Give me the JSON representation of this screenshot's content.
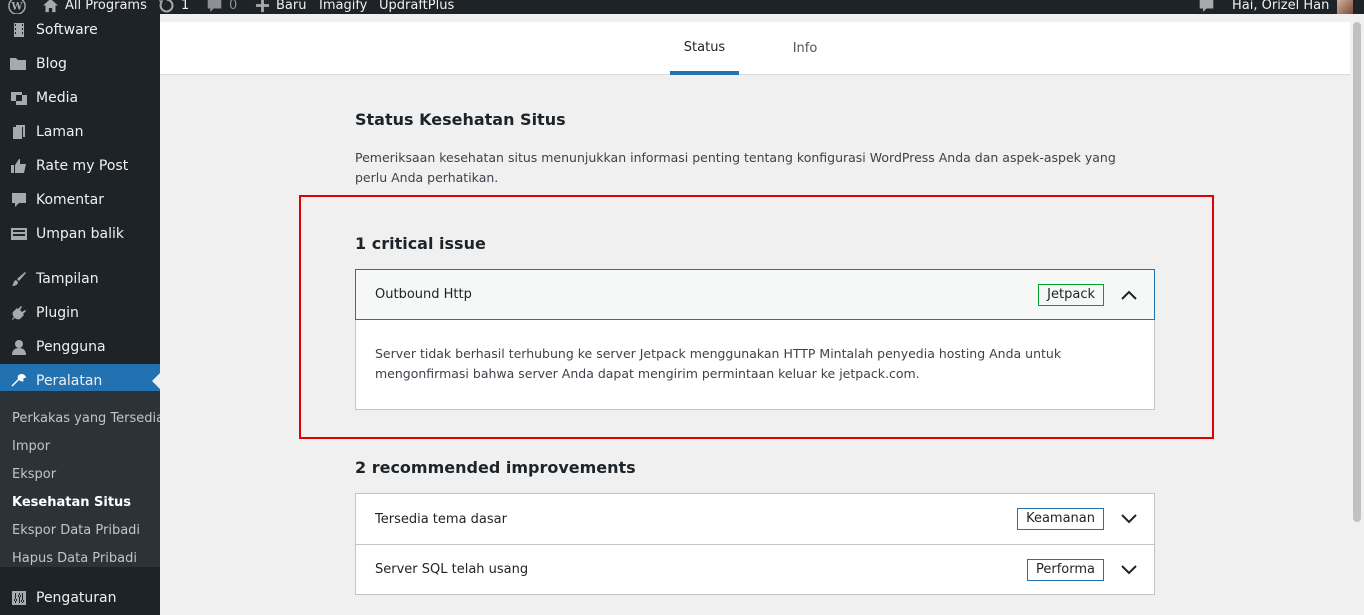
{
  "adminbar": {
    "site_name": "All Programs",
    "updates_count": "1",
    "comments_count": "0",
    "new_label": "Baru",
    "plugin_links": [
      "Imagify",
      "UpdraftPlus"
    ],
    "greeting": "Hai, Orizel Han"
  },
  "sidebar": {
    "items": [
      {
        "label": "Software",
        "icon": "film-icon"
      },
      {
        "label": "Blog",
        "icon": "folder-icon"
      },
      {
        "label": "Media",
        "icon": "media-icon"
      },
      {
        "label": "Laman",
        "icon": "pages-icon"
      },
      {
        "label": "Rate my Post",
        "icon": "thumbs-up-icon"
      },
      {
        "label": "Komentar",
        "icon": "comment-icon"
      },
      {
        "label": "Umpan balik",
        "icon": "feedback-icon"
      },
      {
        "label": "Tampilan",
        "icon": "brush-icon"
      },
      {
        "label": "Plugin",
        "icon": "plug-icon"
      },
      {
        "label": "Pengguna",
        "icon": "user-icon"
      },
      {
        "label": "Peralatan",
        "icon": "wrench-icon"
      },
      {
        "label": "Pengaturan",
        "icon": "settings-icon"
      }
    ],
    "submenu": [
      "Perkakas yang Tersedia",
      "Impor",
      "Ekspor",
      "Kesehatan Situs",
      "Ekspor Data Pribadi",
      "Hapus Data Pribadi"
    ],
    "active_submenu": "Kesehatan Situs"
  },
  "tabs": {
    "status": "Status",
    "info": "Info"
  },
  "main": {
    "title": "Status Kesehatan Situs",
    "description": "Pemeriksaan kesehatan situs menunjukkan informasi penting tentang konfigurasi WordPress Anda dan aspek-aspek yang perlu Anda perhatikan.",
    "critical": {
      "heading": "1 critical issue",
      "items": [
        {
          "label": "Outbound Http",
          "badge": "Jetpack",
          "detail": "Server tidak berhasil terhubung ke server Jetpack menggunakan HTTP Mintalah penyedia hosting Anda untuk mengonfirmasi bahwa server Anda dapat mengirim permintaan keluar ke jetpack.com."
        }
      ]
    },
    "recommended": {
      "heading": "2 recommended improvements",
      "items": [
        {
          "label": "Tersedia tema dasar",
          "badge": "Keamanan"
        },
        {
          "label": "Server SQL telah usang",
          "badge": "Performa"
        }
      ]
    }
  },
  "colors": {
    "admin_dark": "#1d2327",
    "accent": "#2271b1",
    "highlight": "#e00000",
    "badge_green": "#00a32a"
  }
}
